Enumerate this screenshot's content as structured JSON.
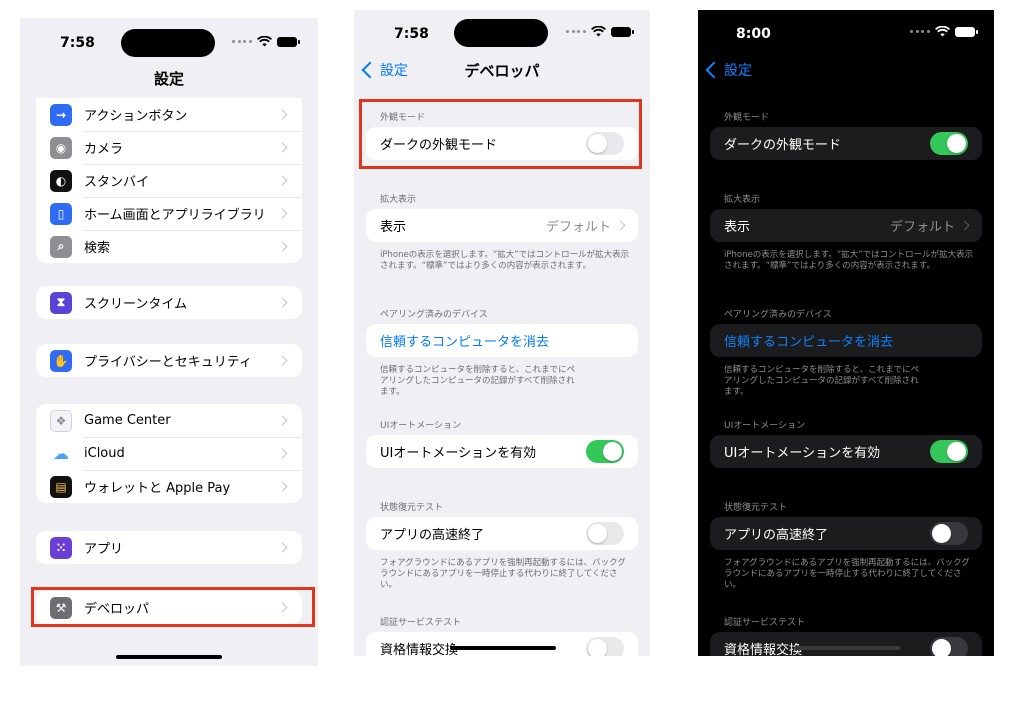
{
  "screen1": {
    "time": "7:58",
    "title": "設定",
    "items_top": [
      {
        "label": "アクションボタン",
        "icon": "action-button-icon",
        "color": "#2f6bf3",
        "glyph": "→"
      },
      {
        "label": "カメラ",
        "icon": "camera-icon",
        "color": "#8e8e93",
        "glyph": "◉"
      },
      {
        "label": "スタンバイ",
        "icon": "standby-icon",
        "color": "#111111",
        "glyph": "◐"
      },
      {
        "label": "ホーム画面とアプリライブラリ",
        "icon": "home-screen-icon",
        "color": "#2f6bf3",
        "glyph": "▯"
      },
      {
        "label": "検索",
        "icon": "search-icon",
        "color": "#8e8e93",
        "glyph": "⌕"
      }
    ],
    "screen_time": {
      "label": "スクリーンタイム",
      "icon": "hourglass-icon",
      "color": "#5b43d6",
      "glyph": "⧗"
    },
    "privacy": {
      "label": "プライバシーとセキュリティ",
      "icon": "hand-icon",
      "color": "#2f6bf3",
      "glyph": "✋"
    },
    "services": [
      {
        "label": "Game Center",
        "icon": "game-center-icon",
        "color": "#f2f2f7",
        "glyph": "❖"
      },
      {
        "label": "iCloud",
        "icon": "icloud-icon",
        "color": "#ffffff",
        "glyph": "☁"
      },
      {
        "label": "ウォレットと Apple Pay",
        "icon": "wallet-icon",
        "color": "#111111",
        "glyph": "▤"
      }
    ],
    "apps": {
      "label": "アプリ",
      "icon": "apps-grid-icon",
      "color": "#6a3fd6",
      "glyph": "⁙"
    },
    "developer": {
      "label": "デベロッパ",
      "icon": "hammer-icon",
      "color": "#6d6d72",
      "glyph": "⚒"
    }
  },
  "screen2": {
    "time": "7:58",
    "back_label": "設定",
    "title": "デベロッパ",
    "appearance_header": "外観モード",
    "dark_mode_label": "ダークの外観モード",
    "dark_mode_on": false,
    "zoom_header": "拡大表示",
    "display_label": "表示",
    "display_value": "デフォルト",
    "display_footnote": "iPhoneの表示を選択します。“拡大”ではコントロールが拡大表示されます。“標準”ではより多くの内容が表示されます。",
    "paired_header": "ペアリング済みのデバイス",
    "clear_trusted_label": "信頼するコンピュータを消去",
    "clear_trusted_footnote": "信頼するコンピュータを削除すると、これまでにペアリングしたコンピュータの記録がすべて削除されます。",
    "ui_automation_header": "UIオートメーション",
    "ui_automation_label": "UIオートメーションを有効",
    "ui_automation_on": true,
    "state_restore_header": "状態復元テスト",
    "fast_quit_label": "アプリの高速終了",
    "fast_quit_on": false,
    "fast_quit_footnote": "フォアグラウンドにあるアプリを強制再起動するには、バックグラウンドにあるアプリを一時停止する代わりに終了してください。",
    "auth_header": "認証サービステスト",
    "credential_exchange_label": "資格情報交換",
    "credential_exchange_on": false
  },
  "screen3": {
    "time": "8:00",
    "back_label": "設定",
    "appearance_header": "外観モード",
    "dark_mode_label": "ダークの外観モード",
    "dark_mode_on": true,
    "zoom_header": "拡大表示",
    "display_label": "表示",
    "display_value": "デフォルト",
    "display_footnote": "iPhoneの表示を選択します。“拡大”ではコントロールが拡大表示されます。“標準”ではより多くの内容が表示されます。",
    "paired_header": "ペアリング済みのデバイス",
    "clear_trusted_label": "信頼するコンピュータを消去",
    "clear_trusted_footnote": "信頼するコンピュータを削除すると、これまでにペアリングしたコンピュータの記録がすべて削除されます。",
    "ui_automation_header": "UIオートメーション",
    "ui_automation_label": "UIオートメーションを有効",
    "ui_automation_on": true,
    "state_restore_header": "状態復元テスト",
    "fast_quit_label": "アプリの高速終了",
    "fast_quit_on": false,
    "fast_quit_footnote": "フォアグラウンドにあるアプリを強制再起動するには、バックグラウンドにあるアプリを一時停止する代わりに終了してください。",
    "auth_header": "認証サービステスト",
    "credential_exchange_label": "資格情報交換",
    "credential_exchange_on": false
  },
  "colors": {
    "highlight": "#e0361c",
    "toggle_on": "#34c759",
    "link_light": "#007aff",
    "link_dark": "#0a84ff"
  }
}
